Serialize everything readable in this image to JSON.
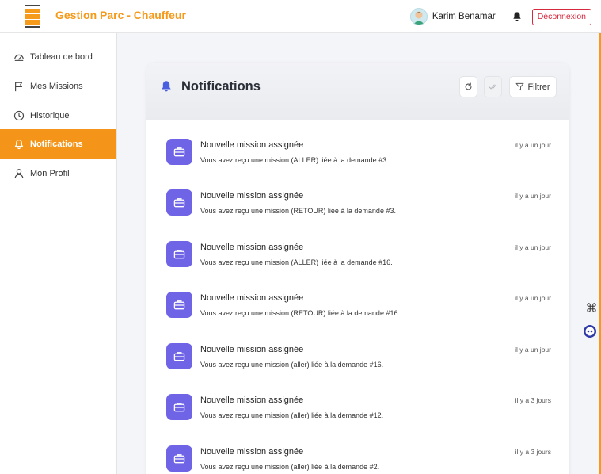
{
  "header": {
    "title": "Gestion Parc - Chauffeur",
    "user_name": "Karim Benamar",
    "logout_label": "Déconnexion"
  },
  "sidebar": {
    "items": [
      {
        "label": "Tableau de bord",
        "icon": "gauge-icon"
      },
      {
        "label": "Mes Missions",
        "icon": "flag-icon"
      },
      {
        "label": "Historique",
        "icon": "clock-icon"
      },
      {
        "label": "Notifications",
        "icon": "bell-icon",
        "active": true
      },
      {
        "label": "Mon Profil",
        "icon": "user-icon"
      }
    ]
  },
  "card": {
    "title": "Notifications",
    "filter_label": "Filtrer"
  },
  "notifications": [
    {
      "title": "Nouvelle mission assignée",
      "message": "Vous avez reçu une mission (ALLER) liée à la demande #3.",
      "time": "il y a un jour"
    },
    {
      "title": "Nouvelle mission assignée",
      "message": "Vous avez reçu une mission (RETOUR) liée à la demande #3.",
      "time": "il y a un jour"
    },
    {
      "title": "Nouvelle mission assignée",
      "message": "Vous avez reçu une mission (ALLER) liée à la demande #16.",
      "time": "il y a un jour"
    },
    {
      "title": "Nouvelle mission assignée",
      "message": "Vous avez reçu une mission (RETOUR) liée à la demande #16.",
      "time": "il y a un jour"
    },
    {
      "title": "Nouvelle mission assignée",
      "message": "Vous avez reçu une mission (aller) liée à la demande #16.",
      "time": "il y a un jour"
    },
    {
      "title": "Nouvelle mission assignée",
      "message": "Vous avez reçu une mission (aller) liée à la demande #12.",
      "time": "il y a 3 jours"
    },
    {
      "title": "Nouvelle mission assignée",
      "message": "Vous avez reçu une mission (aller) liée à la demande #2.",
      "time": "il y a 3 jours"
    }
  ],
  "colors": {
    "brand": "#f59a1a",
    "active_nav": "#f4951a",
    "notif_icon_bg": "#6f63e6",
    "logout": "#d6293e"
  }
}
